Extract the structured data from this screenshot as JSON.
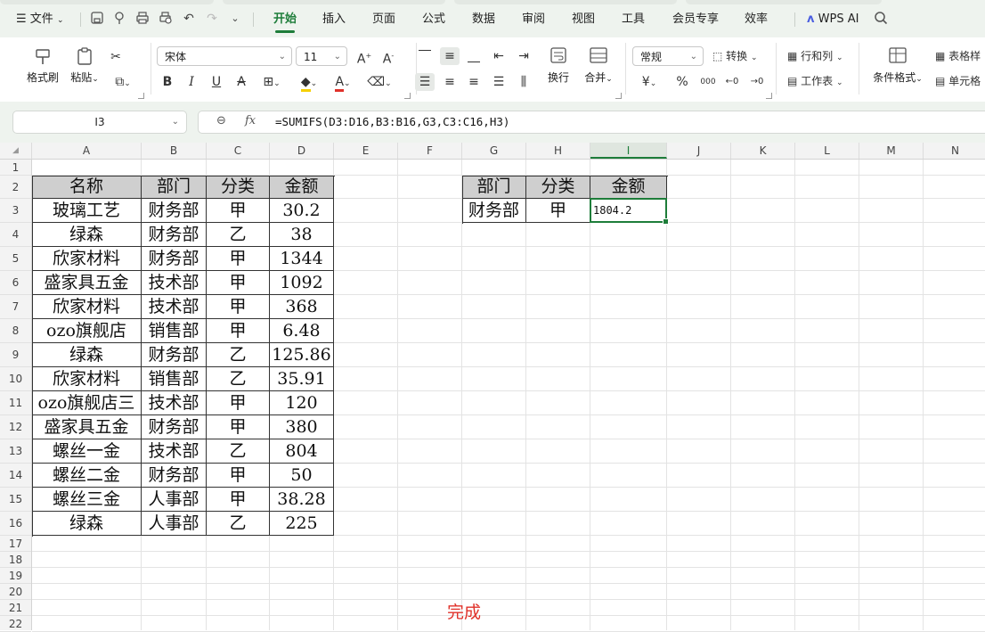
{
  "menubar": {
    "file_label": "文件",
    "tabs": [
      {
        "label": "开始",
        "active": true
      },
      {
        "label": "插入"
      },
      {
        "label": "页面"
      },
      {
        "label": "公式"
      },
      {
        "label": "数据"
      },
      {
        "label": "审阅"
      },
      {
        "label": "视图"
      },
      {
        "label": "工具"
      },
      {
        "label": "会员专享"
      },
      {
        "label": "效率"
      }
    ],
    "wps_ai_label": "WPS AI"
  },
  "ribbon": {
    "format_painter": "格式刷",
    "paste": "粘贴",
    "font_name": "宋体",
    "font_size": "11",
    "wrap_text": "换行",
    "merge": "合并",
    "number_format": "常规",
    "convert": "转换",
    "row_col": "行和列",
    "worksheet": "工作表",
    "cond_format": "条件格式",
    "table_style": "表格样",
    "cell": "单元格",
    "currency_symbol": "¥",
    "percent_symbol": "%",
    "thousands_symbol": "000"
  },
  "formula_bar": {
    "name_box": "I3",
    "fx_label": "fx",
    "formula": "=SUMIFS(D3:D16,B3:B16,G3,C3:C16,H3)"
  },
  "columns": [
    "A",
    "B",
    "C",
    "D",
    "E",
    "F",
    "G",
    "H",
    "I",
    "J",
    "K",
    "L",
    "M",
    "N"
  ],
  "rows": [
    "1",
    "2",
    "3",
    "4",
    "5",
    "6",
    "7",
    "8",
    "9",
    "10",
    "11",
    "12",
    "13",
    "14",
    "15",
    "16",
    "17",
    "18",
    "19",
    "20",
    "21",
    "22"
  ],
  "table_main": {
    "headers": [
      "名称",
      "部门",
      "分类",
      "金额"
    ],
    "rows": [
      [
        "玻璃工艺",
        "财务部",
        "甲",
        "30.2"
      ],
      [
        "绿森",
        "财务部",
        "乙",
        "38"
      ],
      [
        "欣家材料",
        "财务部",
        "甲",
        "1344"
      ],
      [
        "盛家具五金",
        "技术部",
        "甲",
        "1092"
      ],
      [
        "欣家材料",
        "技术部",
        "甲",
        "368"
      ],
      [
        "ozo旗舰店",
        "销售部",
        "甲",
        "6.48"
      ],
      [
        "绿森",
        "财务部",
        "乙",
        "125.86"
      ],
      [
        "欣家材料",
        "销售部",
        "乙",
        "35.91"
      ],
      [
        "ozo旗舰店三",
        "技术部",
        "甲",
        "120"
      ],
      [
        "盛家具五金",
        "财务部",
        "甲",
        "380"
      ],
      [
        "螺丝一金",
        "技术部",
        "乙",
        "804"
      ],
      [
        "螺丝二金",
        "财务部",
        "甲",
        "50"
      ],
      [
        "螺丝三金",
        "人事部",
        "甲",
        "38.28"
      ],
      [
        "绿森",
        "人事部",
        "乙",
        "225"
      ]
    ]
  },
  "table_lookup": {
    "headers": [
      "部门",
      "分类",
      "金额"
    ],
    "row": [
      "财务部",
      "甲",
      "1804.2"
    ]
  },
  "status_caption": "完成",
  "colors": {
    "accent": "#1e7d3a",
    "caption": "#e0312a",
    "header_fill": "#cfcfcf"
  }
}
